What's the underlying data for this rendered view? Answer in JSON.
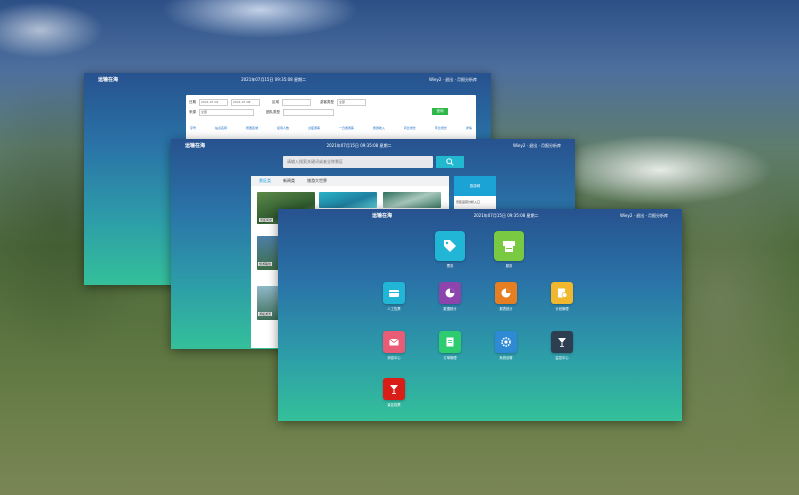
{
  "window_a": {
    "brand": "运输在海",
    "datetime": "2021年07月15日 09:35:08 星期二",
    "user": "Wiey2 · 退出 · 月报分析库",
    "form": {
      "date_label": "日期",
      "date_from": "2021-07-02",
      "date_to": "2021-07-08",
      "region_label": "区域",
      "region_value": "全部",
      "source_label": "来源",
      "route_label": "游客类型",
      "route_value": "全部",
      "type_label": "团队类型",
      "search_button": "查询"
    },
    "columns": [
      "序号",
      "站点名称",
      "所属区域",
      "接待人数",
      "过夜游客",
      "一日游游客",
      "旅游收入",
      "同比增长",
      "环比增长",
      "详情"
    ]
  },
  "window_b": {
    "brand": "运输在海",
    "datetime": "2021年07月15日 09:35:08 星期二",
    "user": "Wiey2 · 退出 · 月报分析库",
    "search_placeholder": "请输入搜索关键词或者全称景区",
    "tabs": [
      "景区类",
      "新闻类",
      "旅游大世界"
    ],
    "photo_captions": [
      "景区风光",
      "旅游路线",
      "游船游览"
    ],
    "side_logo": "旅游网",
    "side_text": "景区运营分析入口"
  },
  "window_c": {
    "brand": "运输在海",
    "datetime": "2021年07月15日 09:35:08 星期二",
    "user": "Wiey2 · 退出 · 月报分析库",
    "apps": [
      {
        "label": "票务",
        "color": "#22b6d6",
        "icon": "tag-icon"
      },
      {
        "label": "服务",
        "color": "#7ac943",
        "icon": "printer-icon"
      },
      {
        "label": "人工售票",
        "color": "#22b6d6",
        "icon": "wallet-icon"
      },
      {
        "label": "数据统计",
        "color": "#8e44ad",
        "icon": "pie-chart-icon"
      },
      {
        "label": "报表统计",
        "color": "#e67e22",
        "icon": "pie-chart-icon"
      },
      {
        "label": "计划管理",
        "color": "#f1b82d",
        "icon": "clock-doc-icon"
      },
      {
        "label": "消息中心",
        "color": "#e85d75",
        "icon": "mail-icon"
      },
      {
        "label": "订单管理",
        "color": "#2ecc71",
        "icon": "list-icon"
      },
      {
        "label": "系统设置",
        "color": "#2f8ad6",
        "icon": "gear-icon"
      },
      {
        "label": "监控中心",
        "color": "#2c3e50",
        "icon": "drink-icon"
      },
      {
        "label": "景区检票",
        "color": "#d91e18",
        "icon": "drink-icon"
      }
    ]
  }
}
